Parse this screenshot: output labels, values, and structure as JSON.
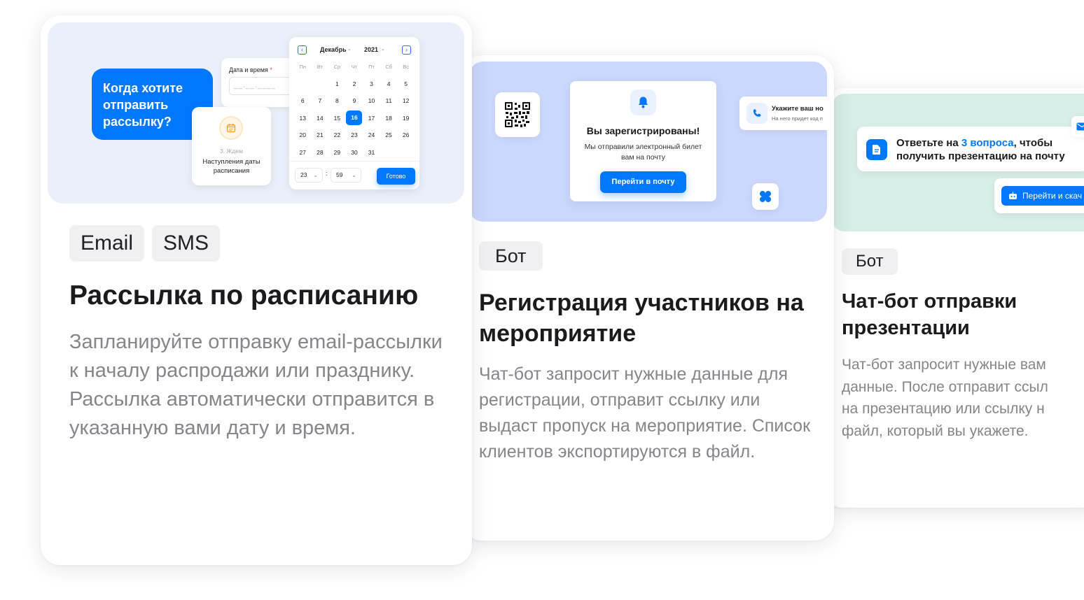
{
  "colors": {
    "accent": "#0077ff",
    "card1_bg": "#eaeff9",
    "card2_bg": "#cbd8fc",
    "card3_bg": "#d7ede8",
    "tag_bg": "#f0f0f2",
    "desc": "#85858c"
  },
  "card1": {
    "tags": [
      "Email",
      "SMS"
    ],
    "title": "Рассылка по расписанию",
    "description": "Запланируйте отправку email-рассылки к началу распродажи или празднику. Рассылка автоматически отправится в указанную вами дату и время.",
    "illustration": {
      "bubble": "Когда хотите отправить рассылку?",
      "field_label": "Дата и время",
      "field_required_mark": "*",
      "field_placeholder": "__.__.____",
      "wait_step": "3. Ждем",
      "wait_text": "Наступления даты расписания",
      "calendar": {
        "prev_icon": "chevron-left-icon",
        "next_icon": "chevron-right-icon",
        "month": "Декабрь",
        "year": "2021",
        "weekdays": [
          "Пн",
          "Вт",
          "Ср",
          "Чт",
          "Пт",
          "Сб",
          "Вс"
        ],
        "weeks": [
          [
            "",
            "",
            "1",
            "2",
            "3",
            "4",
            "5"
          ],
          [
            "6",
            "7",
            "8",
            "9",
            "10",
            "11",
            "12"
          ],
          [
            "13",
            "14",
            "15",
            "16",
            "17",
            "18",
            "19"
          ],
          [
            "20",
            "21",
            "22",
            "23",
            "24",
            "25",
            "26"
          ],
          [
            "27",
            "28",
            "29",
            "30",
            "31",
            "",
            ""
          ]
        ],
        "selected_day": "16",
        "hour": "23",
        "minute": "59",
        "time_separator": ":",
        "done_button": "Готово"
      }
    }
  },
  "card2": {
    "tags": [
      "Бот"
    ],
    "title": "Регистрация участников на мероприятие",
    "description": "Чат-бот запросит нужные данные для регистрации, отправит ссылку или выдаст пропуск на мероприятие. Список клиентов экспортируются в файл.",
    "illustration": {
      "qr_icon": "qr-code-icon",
      "bell_icon": "bell-icon",
      "panel_title": "Вы зарегистрированы!",
      "panel_subtitle": "Мы отправили электронный билет вам на почту",
      "panel_button": "Перейти в почту",
      "phone_title": "Укажите ваш но",
      "phone_subtitle": "На него придет код п",
      "mini_icon": "clover-icon"
    }
  },
  "card3": {
    "tags": [
      "Бот"
    ],
    "title": "Чат-бот отправки презентации",
    "description_lines": [
      "Чат-бот запросит нужные вам",
      "данные. После отправит ссыл",
      "на презентацию или ссылку н",
      "файл, который вы укажете."
    ],
    "illustration": {
      "question_prefix": "Ответьте на ",
      "question_highlight": "3 вопроса",
      "question_suffix": ", чтобы",
      "question_line2": "получить презентацию на почту",
      "download_button": "Перейти и скач"
    }
  }
}
